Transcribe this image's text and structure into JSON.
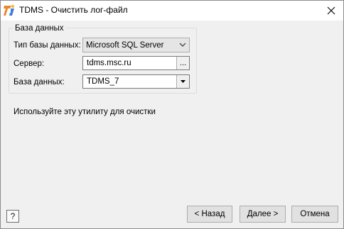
{
  "window": {
    "title": "TDMS - Очистить лог-файл",
    "close_glyph": "✕",
    "app_icon": "tdms-logo-icon"
  },
  "group": {
    "legend": "База данных",
    "db_type_label": "Тип базы данных:",
    "db_type_value": "Microsoft SQL Server",
    "server_label": "Сервер:",
    "server_value": "tdms.msc.ru",
    "browse_label": "...",
    "database_label": "База данных:",
    "database_value": "TDMS_7"
  },
  "info_text": "Используйте эту утилиту для очистки",
  "footer": {
    "help_label": "?",
    "back_label": "< Назад",
    "next_label": "Далее >",
    "cancel_label": "Отмена"
  },
  "colors": {
    "accent_orange": "#e8882b",
    "accent_blue": "#3d7fd8"
  }
}
